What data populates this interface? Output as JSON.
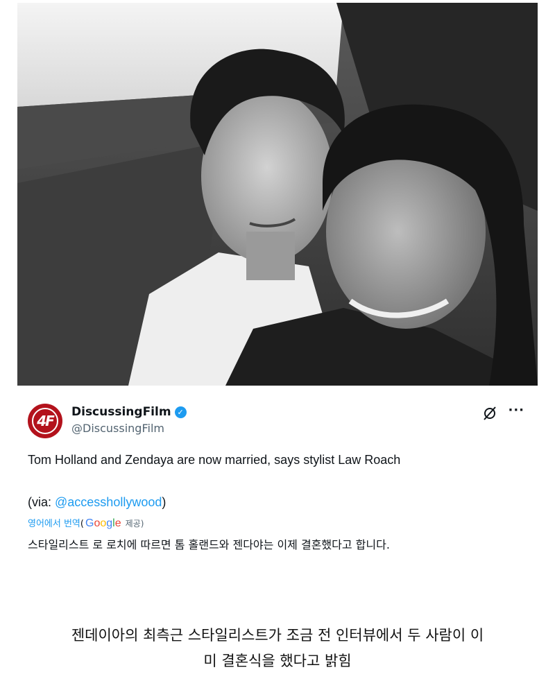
{
  "tweet": {
    "avatar_text": "4F",
    "display_name": "DiscussingFilm",
    "verified_icon": "verified-badge-icon",
    "handle": "@DiscussingFilm",
    "more_label": "···",
    "text": "Tom Holland and Zendaya are now married, says stylist Law Roach",
    "via_prefix": "(via: ",
    "via_mention": "@accesshollywood",
    "via_suffix": ")",
    "translate_label": "영어에서 번역",
    "translate_paren_open": "(",
    "google_g1": "G",
    "google_o1": "o",
    "google_o2": "o",
    "google_g2": "g",
    "google_l": "l",
    "google_e": "e",
    "provided_label": "제공)",
    "translated_text": "스타일리스트 로 로치에 따르면 톰 홀랜드와 젠다야는 이제 결혼했다고 합니다."
  },
  "caption": {
    "line1": "젠데이아의 최측근 스타일리스트가 조금 전 인터뷰에서 두 사람이 이",
    "line2": "미 결혼식을 했다고 밝힘"
  },
  "colors": {
    "link": "#1d9bf0",
    "verified": "#1d9bf0",
    "avatar_bg": "#b3121c"
  }
}
